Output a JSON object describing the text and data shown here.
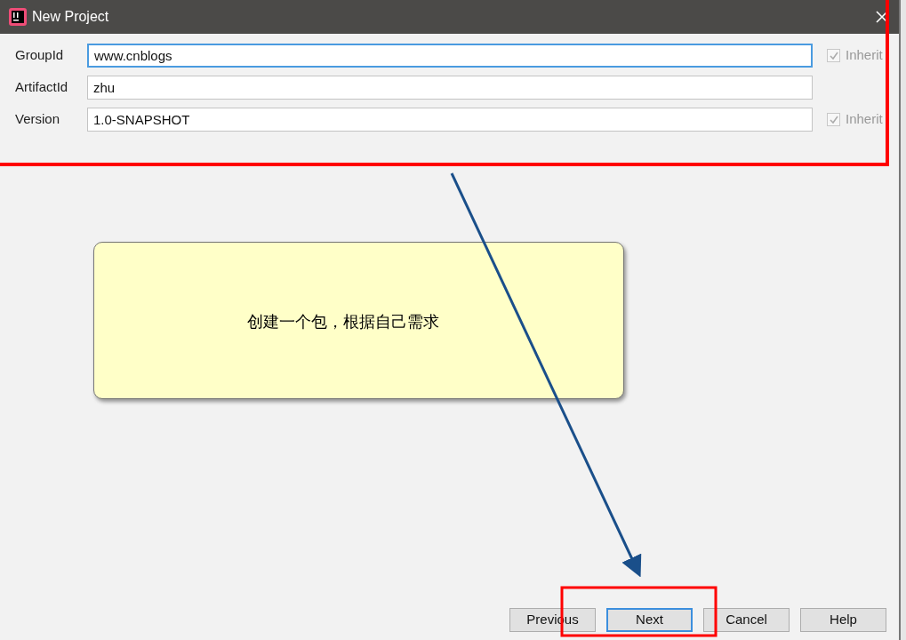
{
  "window": {
    "title": "New Project"
  },
  "fields": [
    {
      "label": "GroupId",
      "value": "www.cnblogs",
      "focused": true,
      "inherit": {
        "label": "Inherit",
        "checked": true,
        "disabled": true
      }
    },
    {
      "label": "ArtifactId",
      "value": "zhu",
      "focused": false
    },
    {
      "label": "Version",
      "value": "1.0-SNAPSHOT",
      "focused": false,
      "inherit": {
        "label": "Inherit",
        "checked": true,
        "disabled": true
      }
    }
  ],
  "callout": {
    "text": "创建一个包，根据自己需求"
  },
  "buttons": [
    {
      "label": "Previous",
      "default": false
    },
    {
      "label": "Next",
      "default": true
    },
    {
      "label": "Cancel",
      "default": false
    },
    {
      "label": "Help",
      "default": false
    }
  ]
}
